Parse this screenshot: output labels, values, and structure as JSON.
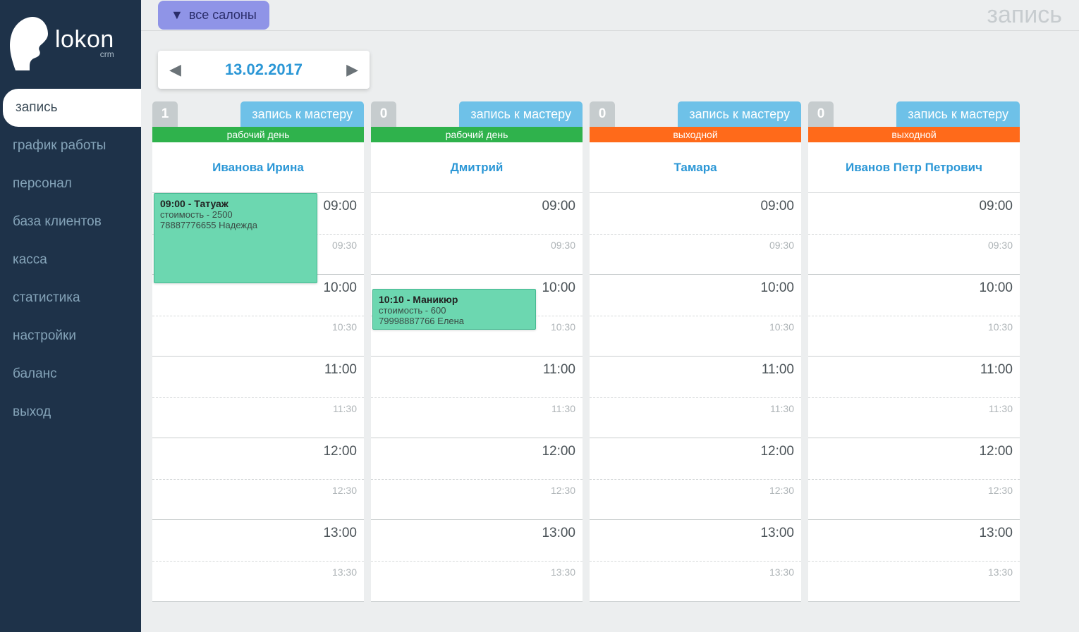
{
  "brand": {
    "name": "lokon",
    "sub": "crm"
  },
  "nav": {
    "items": [
      {
        "label": "запись",
        "active": true
      },
      {
        "label": "график работы",
        "active": false
      },
      {
        "label": "персонал",
        "active": false
      },
      {
        "label": "база клиентов",
        "active": false
      },
      {
        "label": "касса",
        "active": false
      },
      {
        "label": "статистика",
        "active": false
      },
      {
        "label": "настройки",
        "active": false
      },
      {
        "label": "баланс",
        "active": false
      },
      {
        "label": "выход",
        "active": false
      }
    ]
  },
  "header": {
    "salon_picker_label": "все салоны",
    "page_title": "запись"
  },
  "date_picker": {
    "date": "13.02.2017"
  },
  "time_slots": {
    "hours": [
      "09:00",
      "10:00",
      "11:00",
      "12:00",
      "13:00"
    ],
    "halves": [
      "09:30",
      "10:30",
      "11:30",
      "12:30",
      "13:30"
    ]
  },
  "columns": [
    {
      "count": "1",
      "book_label": "запись к мастеру",
      "day_type_label": "рабочий день",
      "day_type": "work",
      "master": "Иванова Ирина",
      "appointments": [
        {
          "title": "09:00 - Татуаж",
          "price": "стоимость - 2500",
          "client": "78887776655 Надежда"
        }
      ]
    },
    {
      "count": "0",
      "book_label": "запись к мастеру",
      "day_type_label": "рабочий день",
      "day_type": "work",
      "master": "Дмитрий",
      "appointments": [
        {
          "title": "10:10 - Маникюр",
          "price": "стоимость - 600",
          "client": "79998887766 Елена"
        }
      ]
    },
    {
      "count": "0",
      "book_label": "запись к мастеру",
      "day_type_label": "выходной",
      "day_type": "off",
      "master": "Тамара",
      "appointments": []
    },
    {
      "count": "0",
      "book_label": "запись к мастеру",
      "day_type_label": "выходной",
      "day_type": "off",
      "master": "Иванов Петр Петрович",
      "appointments": []
    }
  ]
}
